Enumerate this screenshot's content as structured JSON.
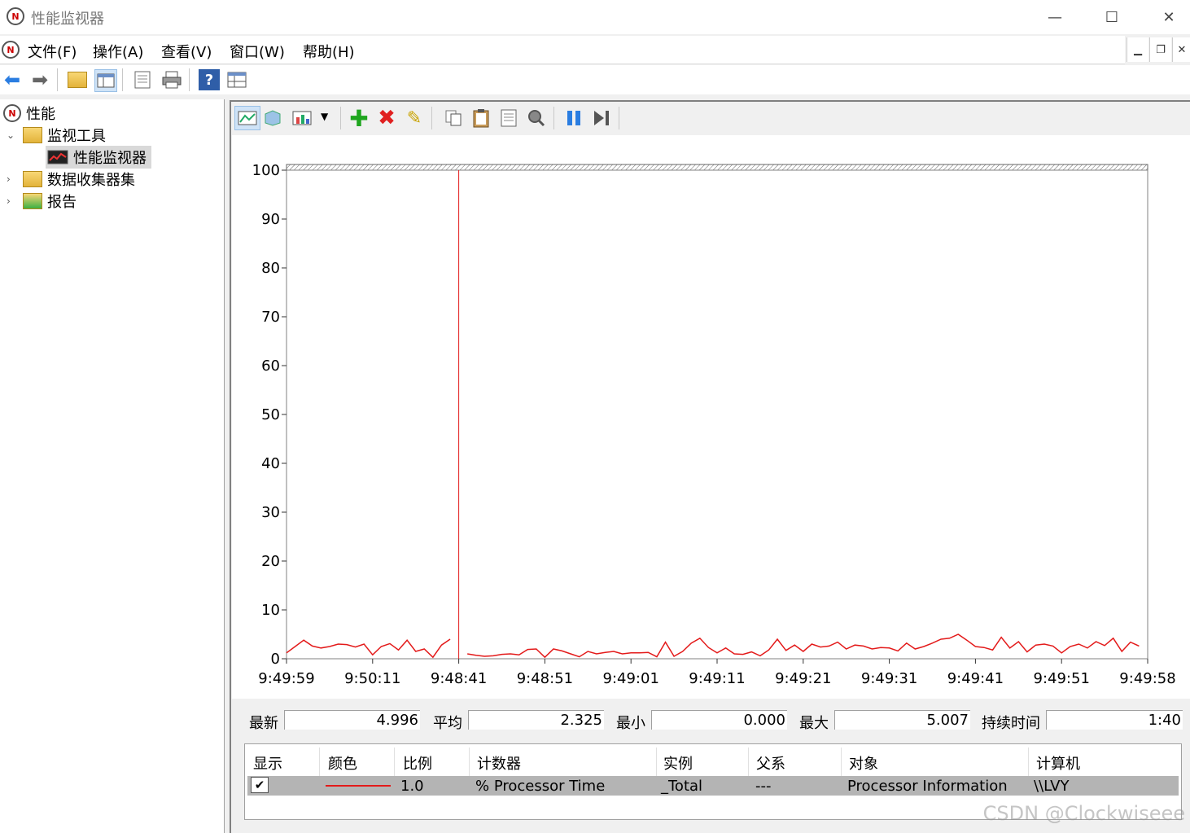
{
  "window": {
    "title": "性能监视器",
    "controls": [
      "—",
      "☐",
      "✕"
    ]
  },
  "menu": {
    "items": [
      "文件(F)",
      "操作(A)",
      "查看(V)",
      "窗口(W)",
      "帮助(H)"
    ]
  },
  "tree": {
    "root": "性能",
    "monitor_tools": "监视工具",
    "perf_monitor": "性能监视器",
    "data_collectors": "数据收集器集",
    "reports": "报告"
  },
  "chart_data": {
    "type": "line",
    "ylim": [
      0,
      100
    ],
    "yticks": [
      0,
      10,
      20,
      30,
      40,
      50,
      60,
      70,
      80,
      90,
      100
    ],
    "xticks": [
      "9:49:59",
      "9:50:11",
      "9:48:41",
      "9:48:51",
      "9:49:01",
      "9:49:11",
      "9:49:21",
      "9:49:31",
      "9:49:41",
      "9:49:51",
      "9:49:58"
    ],
    "series": [
      {
        "color": "#e31a1a",
        "segment_before_cursor": [
          1.2,
          2.5,
          3.8,
          2.6,
          2.2,
          2.5,
          3.0,
          2.9,
          2.4,
          3.0,
          0.8,
          2.5,
          3.1,
          1.8,
          3.8,
          1.5,
          2.0,
          0.3,
          2.8,
          4.0
        ],
        "segment_after_cursor": [
          1.0,
          0.7,
          0.5,
          0.6,
          0.9,
          1.0,
          0.8,
          1.9,
          2.0,
          0.3,
          2.0,
          1.6,
          1.0,
          0.4,
          1.5,
          1.0,
          1.3,
          1.5,
          1.0,
          1.2,
          1.2,
          1.3,
          0.4,
          3.4,
          0.5,
          1.5,
          3.2,
          4.2,
          2.3,
          1.2,
          2.2,
          1.0,
          0.9,
          1.4,
          0.6,
          1.8,
          4.0,
          1.7,
          2.8,
          1.5,
          3.0,
          2.4,
          2.6,
          3.4,
          2.0,
          2.8,
          2.6,
          2.0,
          2.3,
          2.2,
          1.6,
          3.2,
          2.0,
          2.5,
          3.2,
          4.0,
          4.2,
          5.0,
          3.8,
          2.5,
          2.3,
          1.8,
          4.4,
          2.2,
          3.5,
          1.4,
          2.8,
          3.0,
          2.6,
          1.2,
          2.5,
          3.0,
          2.2,
          3.5,
          2.7,
          4.2,
          1.5,
          3.4,
          2.6
        ]
      }
    ]
  },
  "stats": {
    "last_label": "最新",
    "last": "4.996",
    "avg_label": "平均",
    "avg": "2.325",
    "min_label": "最小",
    "min": "0.000",
    "max_label": "最大",
    "max": "5.007",
    "duration_label": "持续时间",
    "duration": "1:40"
  },
  "table": {
    "headers": [
      "显示",
      "颜色",
      "比例",
      "计数器",
      "实例",
      "父系",
      "对象",
      "计算机"
    ],
    "row": {
      "checked": "✔",
      "scale": "1.0",
      "counter": "% Processor Time",
      "instance": "_Total",
      "parent": "---",
      "object": "Processor Information",
      "computer": "\\\\LVY"
    }
  },
  "watermark": "CSDN @Clockwiseee"
}
